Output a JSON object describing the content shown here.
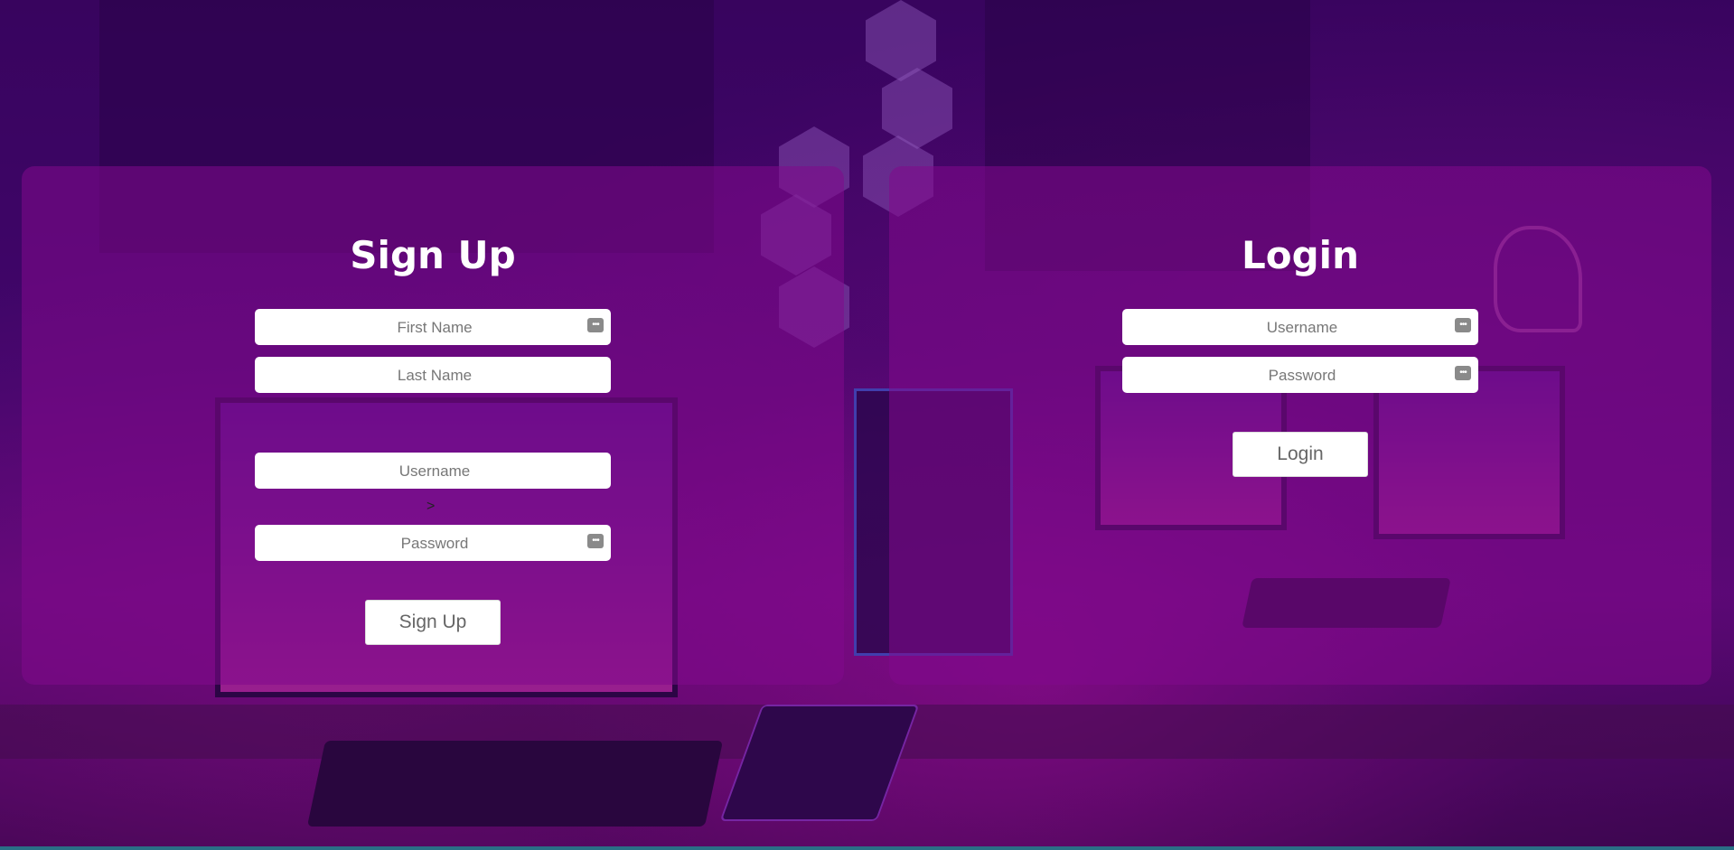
{
  "signup": {
    "title": "Sign Up",
    "first_name_placeholder": "First Name",
    "last_name_placeholder": "Last Name",
    "username_placeholder": "Username",
    "password_placeholder": "Password",
    "arrow": ">",
    "submit_label": "Sign Up"
  },
  "login": {
    "title": "Login",
    "username_placeholder": "Username",
    "password_placeholder": "Password",
    "submit_label": "Login"
  },
  "icons": {
    "field_icon": "password-manager-icon",
    "field_icon_glyph": "•••"
  }
}
